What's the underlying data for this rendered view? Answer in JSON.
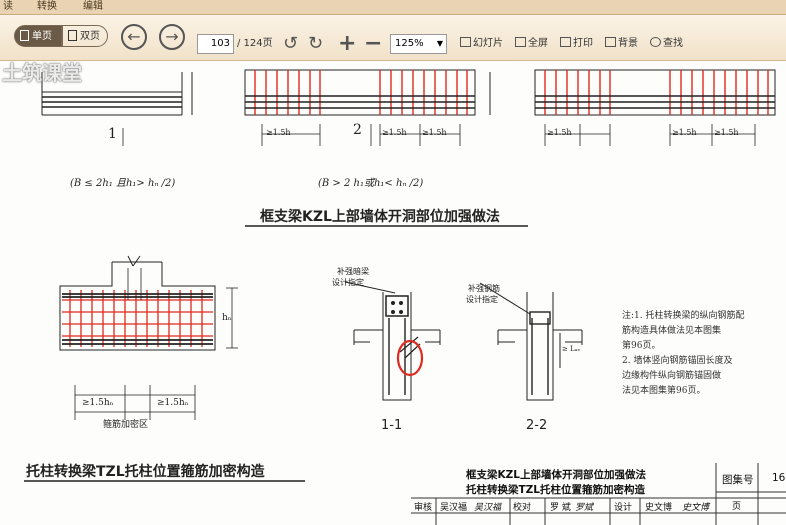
{
  "tabs": [
    "读",
    "转换",
    "编辑"
  ],
  "toolbar": {
    "single_page": "单页",
    "double_page": "双页",
    "page_input": "103",
    "page_total": "/ 124页",
    "zoom": "125%",
    "slideshow": "幻灯片",
    "fullscreen": "全屏",
    "print": "打印",
    "background": "背景",
    "search": "查找"
  },
  "watermark": "土筑课堂",
  "drawing": {
    "fig1_label": "1",
    "fig2_label": "2",
    "dim_label": "≥1.5h",
    "cond1": "(B ≤ 2h₁ 且h₁> hₙ /2)",
    "cond2": "(B > 2 h₁或h₁< hₙ /2)",
    "title_top": "框支梁KZL上部墙体开洞部位加强做法",
    "hb": "hₙ",
    "stirrup_zone": "箍筋加密区",
    "dim_lower1": "≥1.5hₙ",
    "dim_lower2": "≥1.5hₙ",
    "callout1_line1": "补强暗梁",
    "callout1_line2": "设计指定",
    "callout2_line1": "补强钢筋",
    "callout2_line2": "设计指定",
    "lae": "≥ Lₐₑ",
    "section1": "1-1",
    "section2": "2-2",
    "title_bottom": "托柱转换梁TZL托柱位置箍筋加密构造"
  },
  "notes": [
    "注:1. 托柱转换梁的纵向钢筋配",
    "      筋构造具体做法见本图集",
    "      第96页。",
    "   2. 墙体竖向钢筋锚固长度及",
    "      边缘构件纵向钢筋锚固做",
    "      法见本图集第96页。"
  ],
  "titleblock": {
    "title_line1": "框支梁KZL上部墙体开洞部位加强做法",
    "title_line2": "托柱转换梁TZL托柱位置箍筋加密构造",
    "atlas_label": "图集号",
    "atlas_value": "16",
    "page_label": "页",
    "review_label": "审核",
    "review_name": "吴汉福",
    "check_label": "校对",
    "check_name": "罗 斌",
    "design_label": "设计",
    "design_name": "史文博",
    "review_sig": "吴汉福",
    "check_sig": "罗斌",
    "design_sig": "史文博"
  },
  "colors": {
    "rebar_red": "#e02a1f",
    "line_dark": "#222222",
    "toolbar_bg": "#f1e2c9"
  }
}
